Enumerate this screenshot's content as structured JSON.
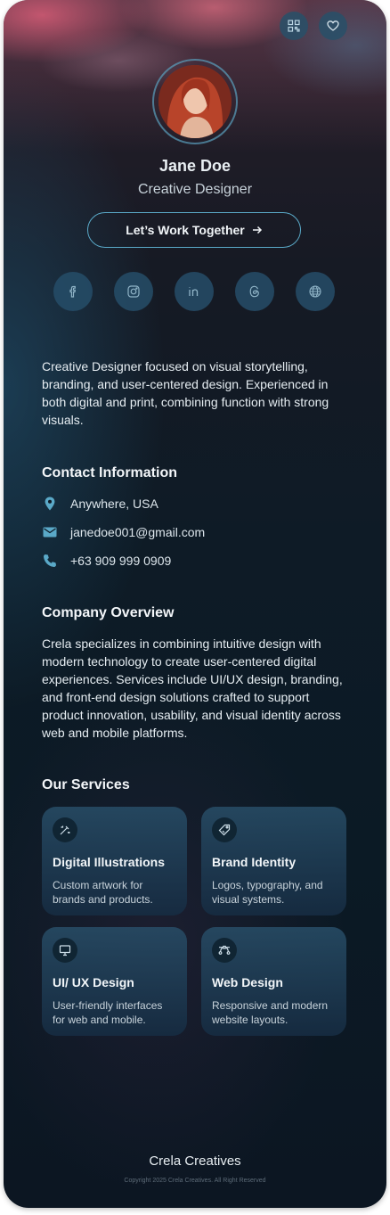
{
  "header": {
    "actions": [
      {
        "icon": "qr-code-icon"
      },
      {
        "icon": "heart-icon"
      }
    ]
  },
  "profile": {
    "name": "Jane Doe",
    "title": "Creative Designer",
    "cta_label": "Let’s Work Together",
    "socials": [
      "facebook-icon",
      "instagram-icon",
      "linkedin-icon",
      "threads-icon",
      "globe-icon"
    ],
    "bio": "Creative Designer focused on visual storytelling, branding, and user-centered design. Experienced in both digital and print, combining function with strong visuals."
  },
  "contact": {
    "title": "Contact Information",
    "items": [
      {
        "icon": "location-icon",
        "text": "Anywhere, USA"
      },
      {
        "icon": "mail-icon",
        "text": "janedoe001@gmail.com"
      },
      {
        "icon": "phone-icon",
        "text": "+63 909 999 0909"
      }
    ]
  },
  "company": {
    "title": "Company Overview",
    "text": "Crela specializes in combining intuitive design with modern technology to create user-centered digital experiences. Services include UI/UX design, branding, and front-end design solutions crafted to support product innovation, usability, and visual identity across web and mobile platforms."
  },
  "services": {
    "title": "Our Services",
    "items": [
      {
        "icon": "pen-tool-icon",
        "title": "Digital Illustrations",
        "desc": "Custom artwork for brands and products."
      },
      {
        "icon": "tag-icon",
        "title": "Brand Identity",
        "desc": "Logos, typography, and visual systems."
      },
      {
        "icon": "monitor-icon",
        "title": "UI/ UX Design",
        "desc": "User-friendly interfaces for web and mobile."
      },
      {
        "icon": "bezier-icon",
        "title": "Web Design",
        "desc": "Responsive and modern website layouts."
      }
    ]
  },
  "footer": {
    "brand": "Crela Creatives",
    "copyright": "Copyright 2025 Crela Creatives. All Right Reserved"
  },
  "colors": {
    "accent": "#5aa9c8",
    "icon_bg": "#264e68",
    "text": "#e6edf2"
  }
}
